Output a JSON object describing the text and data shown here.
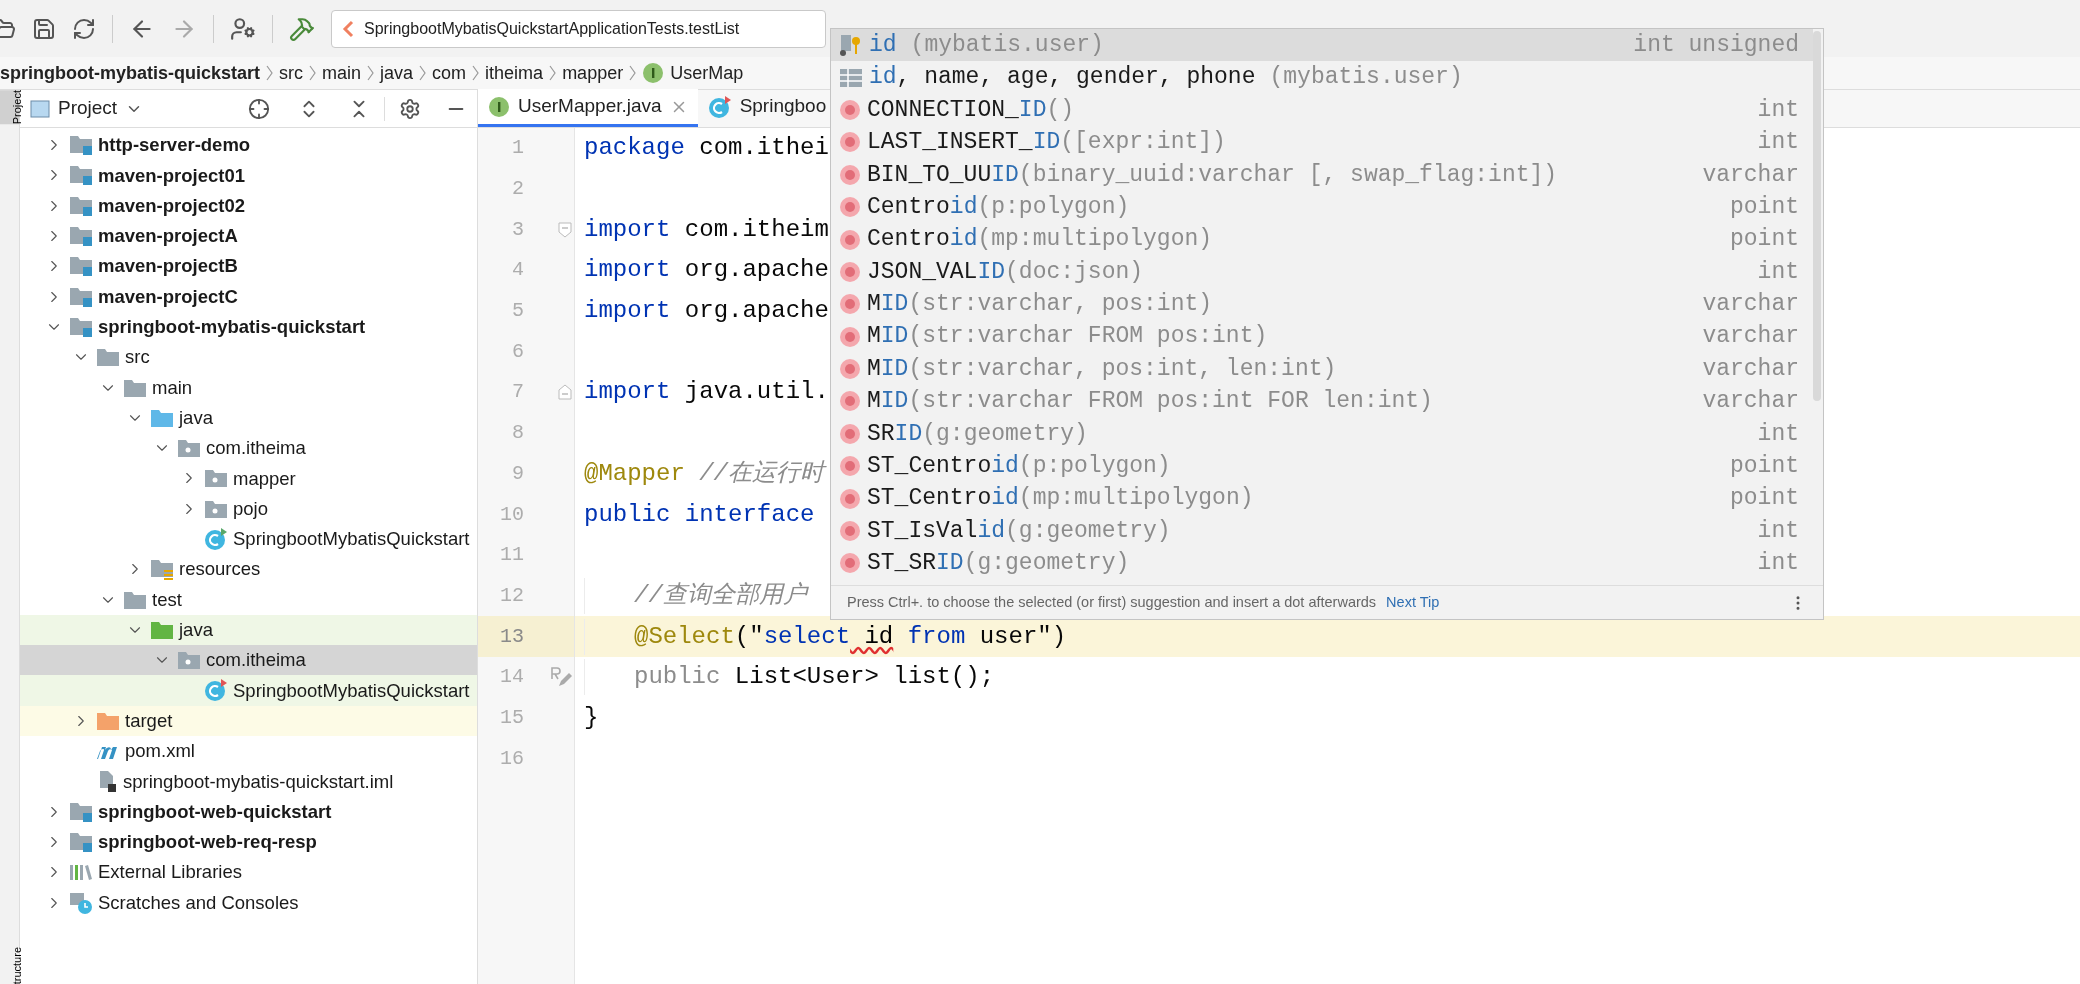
{
  "toolbar": {
    "run_configuration": "SpringbootMybatisQuickstartApplicationTests.testList"
  },
  "breadcrumb": [
    {
      "kind": "module",
      "label": "springboot-mybatis-quickstart"
    },
    {
      "kind": "folder",
      "label": "src"
    },
    {
      "kind": "folder",
      "label": "main"
    },
    {
      "kind": "folder",
      "label": "java"
    },
    {
      "kind": "folder",
      "label": "com"
    },
    {
      "kind": "folder",
      "label": "itheima"
    },
    {
      "kind": "folder",
      "label": "mapper"
    },
    {
      "kind": "interface",
      "label": "UserMap"
    }
  ],
  "side_tabs": [
    {
      "label": "Project",
      "selected": true
    },
    {
      "label": "tructure",
      "selected": false
    }
  ],
  "project_panel": {
    "title": "Project",
    "tree": [
      {
        "label": "http-server-demo",
        "kind": "module",
        "expanded": false,
        "selected": false
      },
      {
        "label": "maven-project01",
        "kind": "module",
        "expanded": false,
        "selected": false
      },
      {
        "label": "maven-project02",
        "kind": "module",
        "expanded": false,
        "selected": false
      },
      {
        "label": "maven-projectA",
        "kind": "module",
        "expanded": false,
        "selected": false
      },
      {
        "label": "maven-projectB",
        "kind": "module",
        "expanded": false,
        "selected": false
      },
      {
        "label": "maven-projectC",
        "kind": "module",
        "expanded": false,
        "selected": false
      },
      {
        "label": "springboot-mybatis-quickstart",
        "kind": "module",
        "expanded": true,
        "selected": false,
        "children": [
          {
            "label": "src",
            "kind": "folder",
            "expanded": true,
            "selected": false,
            "children": [
              {
                "label": "main",
                "kind": "folder",
                "expanded": true,
                "selected": false,
                "children": [
                  {
                    "label": "java",
                    "kind": "source-root",
                    "expanded": true,
                    "selected": false,
                    "children": [
                      {
                        "label": "com.itheima",
                        "kind": "package",
                        "expanded": true,
                        "selected": false,
                        "children": [
                          {
                            "label": "mapper",
                            "kind": "package",
                            "expanded": false,
                            "selected": false
                          },
                          {
                            "label": "pojo",
                            "kind": "package",
                            "expanded": false,
                            "selected": false
                          },
                          {
                            "label": "SpringbootMybatisQuickstart",
                            "kind": "app-class",
                            "selected": false
                          }
                        ]
                      }
                    ]
                  },
                  {
                    "label": "resources",
                    "kind": "resources-root",
                    "expanded": false,
                    "selected": false
                  }
                ]
              },
              {
                "label": "test",
                "kind": "folder",
                "expanded": true,
                "selected": false,
                "children": [
                  {
                    "label": "java",
                    "kind": "test-root",
                    "expanded": true,
                    "selected": false,
                    "children": [
                      {
                        "label": "com.itheima",
                        "kind": "package",
                        "expanded": true,
                        "selected": true,
                        "children": [
                          {
                            "label": "SpringbootMybatisQuickstart",
                            "kind": "test-class",
                            "selected": false
                          }
                        ]
                      }
                    ]
                  }
                ]
              }
            ]
          },
          {
            "label": "target",
            "kind": "excluded",
            "expanded": false,
            "selected": false
          },
          {
            "label": "pom.xml",
            "kind": "maven",
            "selected": false
          },
          {
            "label": "springboot-mybatis-quickstart.iml",
            "kind": "iml",
            "selected": false
          }
        ]
      },
      {
        "label": "springboot-web-quickstart",
        "kind": "module",
        "expanded": false,
        "selected": false
      },
      {
        "label": "springboot-web-req-resp",
        "kind": "module",
        "expanded": false,
        "selected": false
      },
      {
        "label": "External Libraries",
        "kind": "libraries",
        "expanded": false,
        "selected": false
      },
      {
        "label": "Scratches and Consoles",
        "kind": "scratches",
        "expanded": false,
        "selected": false
      }
    ]
  },
  "editor": {
    "tabs": [
      {
        "label": "UserMapper.java",
        "kind": "interface",
        "selected": true,
        "closable": true
      },
      {
        "label": "Springboo",
        "kind": "test-class",
        "selected": false,
        "closable": false
      }
    ],
    "lines": [
      {
        "number": "1",
        "current": false,
        "tokens": [
          {
            "kind": "keyword",
            "text": "package"
          },
          {
            "kind": "plain",
            "text": " com.ithei"
          }
        ]
      },
      {
        "number": "2",
        "current": false
      },
      {
        "number": "3",
        "current": false,
        "gutter": {
          "kind": "fold-start"
        },
        "tokens": [
          {
            "kind": "keyword",
            "text": "import"
          },
          {
            "kind": "plain",
            "text": " com.itheim"
          }
        ]
      },
      {
        "number": "4",
        "current": false,
        "tokens": [
          {
            "kind": "keyword",
            "text": "import"
          },
          {
            "kind": "plain",
            "text": " org.apache"
          }
        ]
      },
      {
        "number": "5",
        "current": false,
        "tokens": [
          {
            "kind": "keyword",
            "text": "import"
          },
          {
            "kind": "plain",
            "text": " org.apache"
          }
        ]
      },
      {
        "number": "6",
        "current": false
      },
      {
        "number": "7",
        "current": false,
        "gutter": {
          "kind": "fold-end"
        },
        "tokens": [
          {
            "kind": "keyword",
            "text": "import"
          },
          {
            "kind": "plain",
            "text": " java.util."
          }
        ]
      },
      {
        "number": "8",
        "current": false
      },
      {
        "number": "9",
        "current": false,
        "tokens": [
          {
            "kind": "annotation",
            "text": "@Mapper "
          },
          {
            "kind": "comment",
            "text": "//在运行时"
          }
        ]
      },
      {
        "number": "10",
        "current": false,
        "tokens": [
          {
            "kind": "keyword",
            "text": "public interface"
          }
        ]
      },
      {
        "number": "11",
        "current": false
      },
      {
        "number": "12",
        "current": false,
        "indented": true,
        "tokens": [
          {
            "kind": "comment",
            "text": "//查询全部用户"
          }
        ]
      },
      {
        "number": "13",
        "current": true,
        "indented": true,
        "tokens": [
          {
            "kind": "annotation",
            "text": "@Select"
          },
          {
            "kind": "plain",
            "text": "(\""
          },
          {
            "kind": "sql-keyword",
            "text": "select"
          },
          {
            "kind": "error",
            "text": " id"
          },
          {
            "kind": "sql-keyword",
            "text": " from"
          },
          {
            "kind": "plain",
            "text": " user\")"
          }
        ]
      },
      {
        "number": "14",
        "current": false,
        "indented": true,
        "gutter": {
          "kind": "mapper-statement"
        },
        "tokens": [
          {
            "kind": "redundant",
            "text": "public"
          },
          {
            "kind": "plain",
            "text": " List<User> list();"
          }
        ]
      },
      {
        "number": "15",
        "current": false,
        "tokens": [
          {
            "kind": "plain",
            "text": "}"
          }
        ]
      },
      {
        "number": "16",
        "current": false
      }
    ]
  },
  "completion_popup": {
    "items": [
      {
        "kind": "column",
        "selected": true,
        "match": "id",
        "params": "(mybatis.user)",
        "type": "int unsigned"
      },
      {
        "kind": "table",
        "selected": false,
        "match": "id",
        "after": ", name, age, gender, phone",
        "params": "(mybatis.user)"
      },
      {
        "kind": "function",
        "selected": false,
        "before": "CONNECTION_",
        "match": "ID",
        "params": "()",
        "type": "int"
      },
      {
        "kind": "function",
        "selected": false,
        "before": "LAST_INSERT_",
        "match": "ID",
        "params": "([expr:int])",
        "type": "int"
      },
      {
        "kind": "function",
        "selected": false,
        "before": "BIN_TO_UU",
        "match": "ID",
        "params": "(binary_uuid:varchar [, swap_flag:int])",
        "type": "varchar"
      },
      {
        "kind": "function",
        "selected": false,
        "before": "Centro",
        "match": "id",
        "params": "(p:polygon)",
        "type": "point"
      },
      {
        "kind": "function",
        "selected": false,
        "before": "Centro",
        "match": "id",
        "params": "(mp:multipolygon)",
        "type": "point"
      },
      {
        "kind": "function",
        "selected": false,
        "before": "JSON_VAL",
        "match": "ID",
        "params": "(doc:json)",
        "type": "int"
      },
      {
        "kind": "function",
        "selected": false,
        "before": "M",
        "match": "ID",
        "params": "(str:varchar, pos:int)",
        "type": "varchar"
      },
      {
        "kind": "function",
        "selected": false,
        "before": "M",
        "match": "ID",
        "params": "(str:varchar FROM pos:int)",
        "type": "varchar"
      },
      {
        "kind": "function",
        "selected": false,
        "before": "M",
        "match": "ID",
        "params": "(str:varchar, pos:int, len:int)",
        "type": "varchar"
      },
      {
        "kind": "function",
        "selected": false,
        "before": "M",
        "match": "ID",
        "params": "(str:varchar FROM pos:int FOR len:int)",
        "type": "varchar"
      },
      {
        "kind": "function",
        "selected": false,
        "before": "SR",
        "match": "ID",
        "params": "(g:geometry)",
        "type": "int"
      },
      {
        "kind": "function",
        "selected": false,
        "before": "ST_Centro",
        "match": "id",
        "params": "(p:polygon)",
        "type": "point"
      },
      {
        "kind": "function",
        "selected": false,
        "before": "ST_Centro",
        "match": "id",
        "params": "(mp:multipolygon)",
        "type": "point"
      },
      {
        "kind": "function",
        "selected": false,
        "before": "ST_IsVal",
        "match": "id",
        "params": "(g:geometry)",
        "type": "int"
      },
      {
        "kind": "function",
        "selected": false,
        "before": "ST_SR",
        "match": "ID",
        "params": "(g:geometry)",
        "type": "int"
      }
    ],
    "hint": "Press Ctrl+. to choose the selected (or first) suggestion and insert a dot afterwards",
    "next_tip": "Next Tip"
  }
}
